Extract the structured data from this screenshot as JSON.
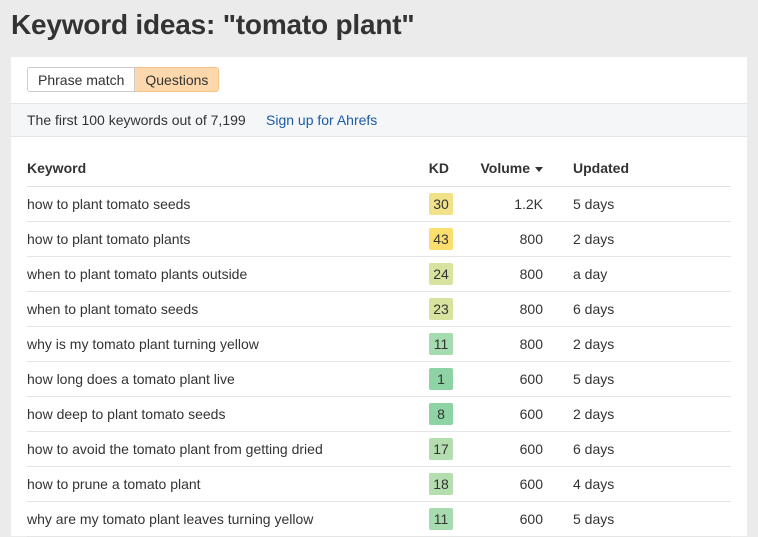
{
  "header": {
    "title": "Keyword ideas: \"tomato plant\""
  },
  "tabs": [
    {
      "label": "Phrase match",
      "active": false
    },
    {
      "label": "Questions",
      "active": true
    }
  ],
  "infobar": {
    "count_text": "The first 100 keywords out of 7,199",
    "signup_link": "Sign up for Ahrefs"
  },
  "table": {
    "columns": {
      "keyword": "Keyword",
      "kd": "KD",
      "volume": "Volume",
      "updated": "Updated"
    },
    "sort_icon": "caret-down-icon",
    "rows": [
      {
        "keyword": "how to plant tomato seeds",
        "kd": "30",
        "kd_color": "#f1e28a",
        "volume": "1.2K",
        "updated": "5 days"
      },
      {
        "keyword": "how to plant tomato plants",
        "kd": "43",
        "kd_color": "#fbdf6e",
        "volume": "800",
        "updated": "2 days"
      },
      {
        "keyword": "when to plant tomato plants outside",
        "kd": "24",
        "kd_color": "#d9e3a0",
        "volume": "800",
        "updated": "a day"
      },
      {
        "keyword": "when to plant tomato seeds",
        "kd": "23",
        "kd_color": "#d9e3a0",
        "volume": "800",
        "updated": "6 days"
      },
      {
        "keyword": "why is my tomato plant turning yellow",
        "kd": "11",
        "kd_color": "#a6dbb0",
        "volume": "800",
        "updated": "2 days"
      },
      {
        "keyword": "how long does a tomato plant live",
        "kd": "1",
        "kd_color": "#8dd3a4",
        "volume": "600",
        "updated": "5 days"
      },
      {
        "keyword": "how deep to plant tomato seeds",
        "kd": "8",
        "kd_color": "#8dd3a4",
        "volume": "600",
        "updated": "2 days"
      },
      {
        "keyword": "how to avoid the tomato plant from getting dried",
        "kd": "17",
        "kd_color": "#b4ddb0",
        "volume": "600",
        "updated": "6 days"
      },
      {
        "keyword": "how to prune a tomato plant",
        "kd": "18",
        "kd_color": "#b4ddb0",
        "volume": "600",
        "updated": "4 days"
      },
      {
        "keyword": "why are my tomato plant leaves turning yellow",
        "kd": "11",
        "kd_color": "#a6dbb0",
        "volume": "600",
        "updated": "5 days"
      }
    ]
  }
}
